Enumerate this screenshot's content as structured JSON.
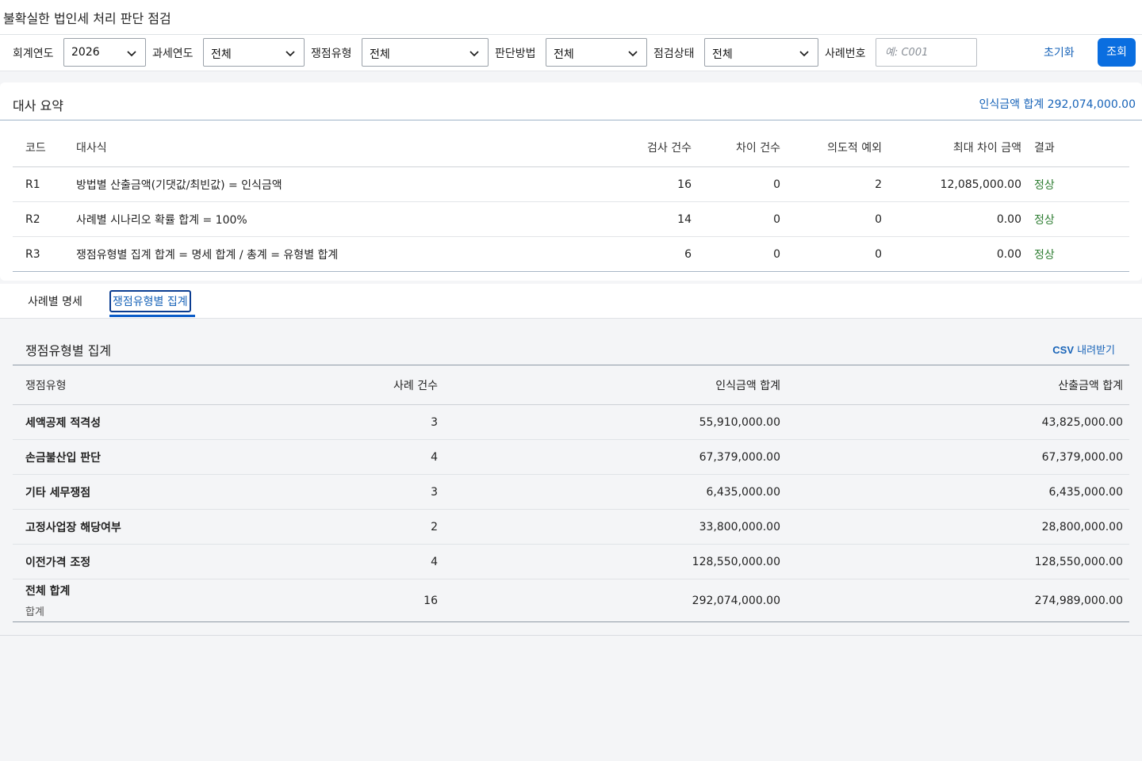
{
  "page": {
    "title": "불확실한 법인세 처리 판단 점검"
  },
  "filters": {
    "fiscal_year": {
      "label": "회계연도",
      "value": "2026"
    },
    "tax_year": {
      "label": "과세연도",
      "value": "전체"
    },
    "issue_type": {
      "label": "쟁점유형",
      "value": "전체"
    },
    "method": {
      "label": "판단방법",
      "value": "전체"
    },
    "status": {
      "label": "점검상태",
      "value": "전체"
    },
    "case_no": {
      "label": "사례번호",
      "placeholder": "예: C001"
    },
    "reset_label": "초기화",
    "search_label": "조회",
    "icons": {
      "dropdown": "chevron-down-icon"
    }
  },
  "summary": {
    "title": "대사 요약",
    "total_text": "인식금액 합계 292,074,000.00",
    "columns": [
      "코드",
      "대사식",
      "검사 건수",
      "차이 건수",
      "의도적 예외",
      "최대 차이 금액",
      "결과"
    ],
    "rows": [
      {
        "code": "R1",
        "formula": "방법별 산출금액(기댓값/최빈값) = 인식금액",
        "checked": "16",
        "diff": "0",
        "intentional": "2",
        "max_diff": "12,085,000.00",
        "result": "정상"
      },
      {
        "code": "R2",
        "formula": "사례별 시나리오 확률 합계 = 100%",
        "checked": "14",
        "diff": "0",
        "intentional": "0",
        "max_diff": "0.00",
        "result": "정상"
      },
      {
        "code": "R3",
        "formula": "쟁점유형별 집계 합계 = 명세 합계 / 총계 = 유형별 합계",
        "checked": "6",
        "diff": "0",
        "intentional": "0",
        "max_diff": "0.00",
        "result": "정상"
      }
    ]
  },
  "tabs": [
    {
      "label": "사례별 명세",
      "active": false
    },
    {
      "label": "쟁점유형별 집계",
      "active": true
    }
  ],
  "aggregate": {
    "title": "쟁점유형별 집계",
    "csv_prefix": "CSV",
    "csv_suffix": " 내려받기",
    "columns": [
      "쟁점유형",
      "사례 건수",
      "인식금액 합계",
      "산출금액 합계"
    ],
    "rows": [
      {
        "type": "세액공제 적격성",
        "count": "3",
        "recognized": "55,910,000.00",
        "calculated": "43,825,000.00"
      },
      {
        "type": "손금불산입 판단",
        "count": "4",
        "recognized": "67,379,000.00",
        "calculated": "67,379,000.00"
      },
      {
        "type": "기타 세무쟁점",
        "count": "3",
        "recognized": "6,435,000.00",
        "calculated": "6,435,000.00"
      },
      {
        "type": "고정사업장 해당여부",
        "count": "2",
        "recognized": "33,800,000.00",
        "calculated": "28,800,000.00"
      },
      {
        "type": "이전가격 조정",
        "count": "4",
        "recognized": "128,550,000.00",
        "calculated": "128,550,000.00"
      }
    ],
    "total": {
      "type": "전체 합계",
      "sub": "합계",
      "count": "16",
      "recognized": "292,074,000.00",
      "calculated": "274,989,000.00"
    }
  },
  "colors": {
    "accent": "#0a6ee0",
    "link": "#1763b8",
    "ok": "#2e7d32"
  }
}
